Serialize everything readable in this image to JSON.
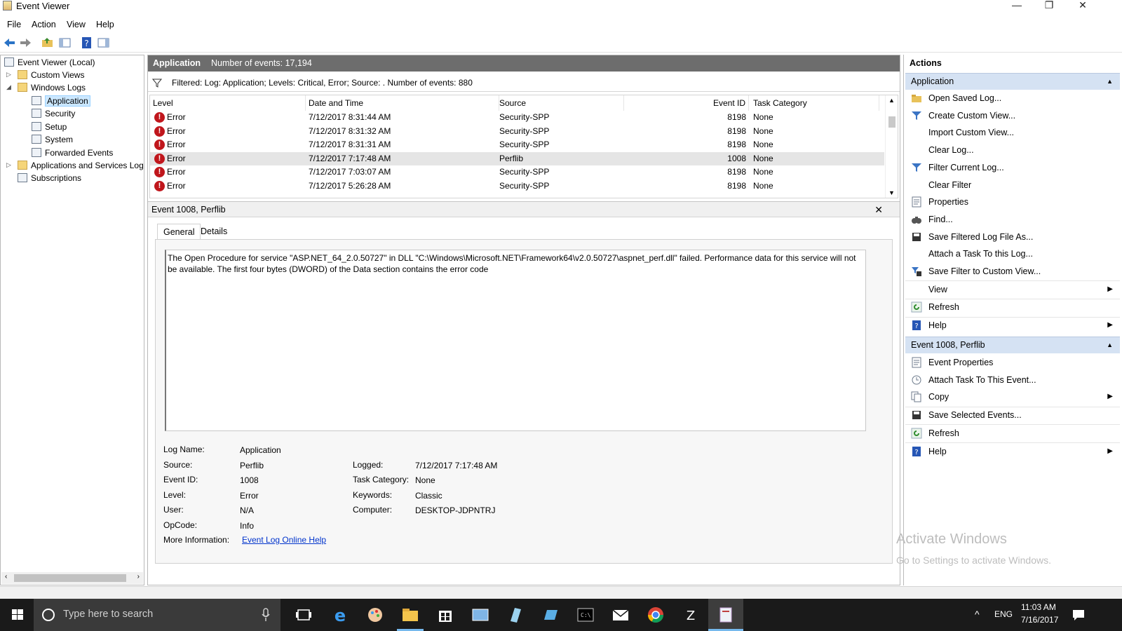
{
  "window": {
    "title": "Event Viewer"
  },
  "menu": [
    "File",
    "Action",
    "View",
    "Help"
  ],
  "tree": {
    "root": "Event Viewer (Local)",
    "items": [
      {
        "label": "Custom Views"
      },
      {
        "label": "Windows Logs"
      },
      {
        "label": "Application"
      },
      {
        "label": "Security"
      },
      {
        "label": "Setup"
      },
      {
        "label": "System"
      },
      {
        "label": "Forwarded Events"
      },
      {
        "label": "Applications and Services Log"
      },
      {
        "label": "Subscriptions"
      }
    ]
  },
  "log_header": {
    "name": "Application",
    "count_text": "Number of events: 17,194"
  },
  "filter_text": "Filtered: Log: Application; Levels: Critical, Error; Source: . Number of events: 880",
  "columns": {
    "level": "Level",
    "date": "Date and Time",
    "source": "Source",
    "event_id": "Event ID",
    "task": "Task Category"
  },
  "events": [
    {
      "level": "Error",
      "date": "7/12/2017 8:31:44 AM",
      "source": "Security-SPP",
      "event_id": "8198",
      "task": "None"
    },
    {
      "level": "Error",
      "date": "7/12/2017 8:31:32 AM",
      "source": "Security-SPP",
      "event_id": "8198",
      "task": "None"
    },
    {
      "level": "Error",
      "date": "7/12/2017 8:31:31 AM",
      "source": "Security-SPP",
      "event_id": "8198",
      "task": "None"
    },
    {
      "level": "Error",
      "date": "7/12/2017 7:17:48 AM",
      "source": "Perflib",
      "event_id": "1008",
      "task": "None"
    },
    {
      "level": "Error",
      "date": "7/12/2017 7:03:07 AM",
      "source": "Security-SPP",
      "event_id": "8198",
      "task": "None"
    },
    {
      "level": "Error",
      "date": "7/12/2017 5:26:28 AM",
      "source": "Security-SPP",
      "event_id": "8198",
      "task": "None"
    }
  ],
  "detail": {
    "title": "Event 1008, Perflib",
    "tabs": [
      "General",
      "Details"
    ],
    "description": "The Open Procedure for service \"ASP.NET_64_2.0.50727\" in DLL \"C:\\Windows\\Microsoft.NET\\Framework64\\v2.0.50727\\aspnet_perf.dll\" failed. Performance data for this service will not be available. The first four bytes (DWORD) of the Data section contains the error code",
    "labels": {
      "log_name": "Log Name:",
      "source": "Source:",
      "event_id": "Event ID:",
      "level": "Level:",
      "user": "User:",
      "opcode": "OpCode:",
      "more_info": "More Information:",
      "logged": "Logged:",
      "task_category": "Task Category:",
      "keywords": "Keywords:",
      "computer": "Computer:"
    },
    "values": {
      "log_name": "Application",
      "source": "Perflib",
      "event_id": "1008",
      "level": "Error",
      "user": "N/A",
      "opcode": "Info",
      "more_info": "Event Log Online Help",
      "logged": "7/12/2017 7:17:48 AM",
      "task_category": "None",
      "keywords": "Classic",
      "computer": "DESKTOP-JDPNTRJ"
    }
  },
  "actions": {
    "title": "Actions",
    "section1": "Application",
    "section1_items": [
      {
        "label": "Open Saved Log...",
        "icon": "open-folder-icon"
      },
      {
        "label": "Create Custom View...",
        "icon": "funnel-icon"
      },
      {
        "label": "Import Custom View...",
        "icon": ""
      },
      {
        "label": "Clear Log...",
        "icon": ""
      },
      {
        "label": "Filter Current Log...",
        "icon": "funnel-icon"
      },
      {
        "label": "Clear Filter",
        "icon": ""
      },
      {
        "label": "Properties",
        "icon": "properties-icon"
      },
      {
        "label": "Find...",
        "icon": "binoculars-icon"
      },
      {
        "label": "Save Filtered Log File As...",
        "icon": "save-icon"
      },
      {
        "label": "Attach a Task To this Log...",
        "icon": ""
      },
      {
        "label": "Save Filter to Custom View...",
        "icon": "save-filter-icon"
      },
      {
        "label": "View",
        "icon": ""
      },
      {
        "label": "Refresh",
        "icon": "refresh-icon"
      },
      {
        "label": "Help",
        "icon": "help-icon"
      }
    ],
    "section2": "Event 1008, Perflib",
    "section2_items": [
      {
        "label": "Event Properties",
        "icon": "properties-icon"
      },
      {
        "label": "Attach Task To This Event...",
        "icon": "task-icon"
      },
      {
        "label": "Copy",
        "icon": "copy-icon"
      },
      {
        "label": "Save Selected Events...",
        "icon": "save-icon"
      },
      {
        "label": "Refresh",
        "icon": "refresh-icon"
      },
      {
        "label": "Help",
        "icon": "help-icon"
      }
    ]
  },
  "watermark": {
    "line1": "Activate Windows",
    "line2": "Go to Settings to activate Windows."
  },
  "taskbar": {
    "search_placeholder": "Type here to search",
    "lang": "ENG",
    "time": "11:03 AM",
    "date": "7/16/2017"
  },
  "colors": {
    "error_red": "#c0161c",
    "section_blue": "#d5e2f3",
    "header_gray": "#6d6d6d",
    "link_blue": "#0033cc"
  }
}
